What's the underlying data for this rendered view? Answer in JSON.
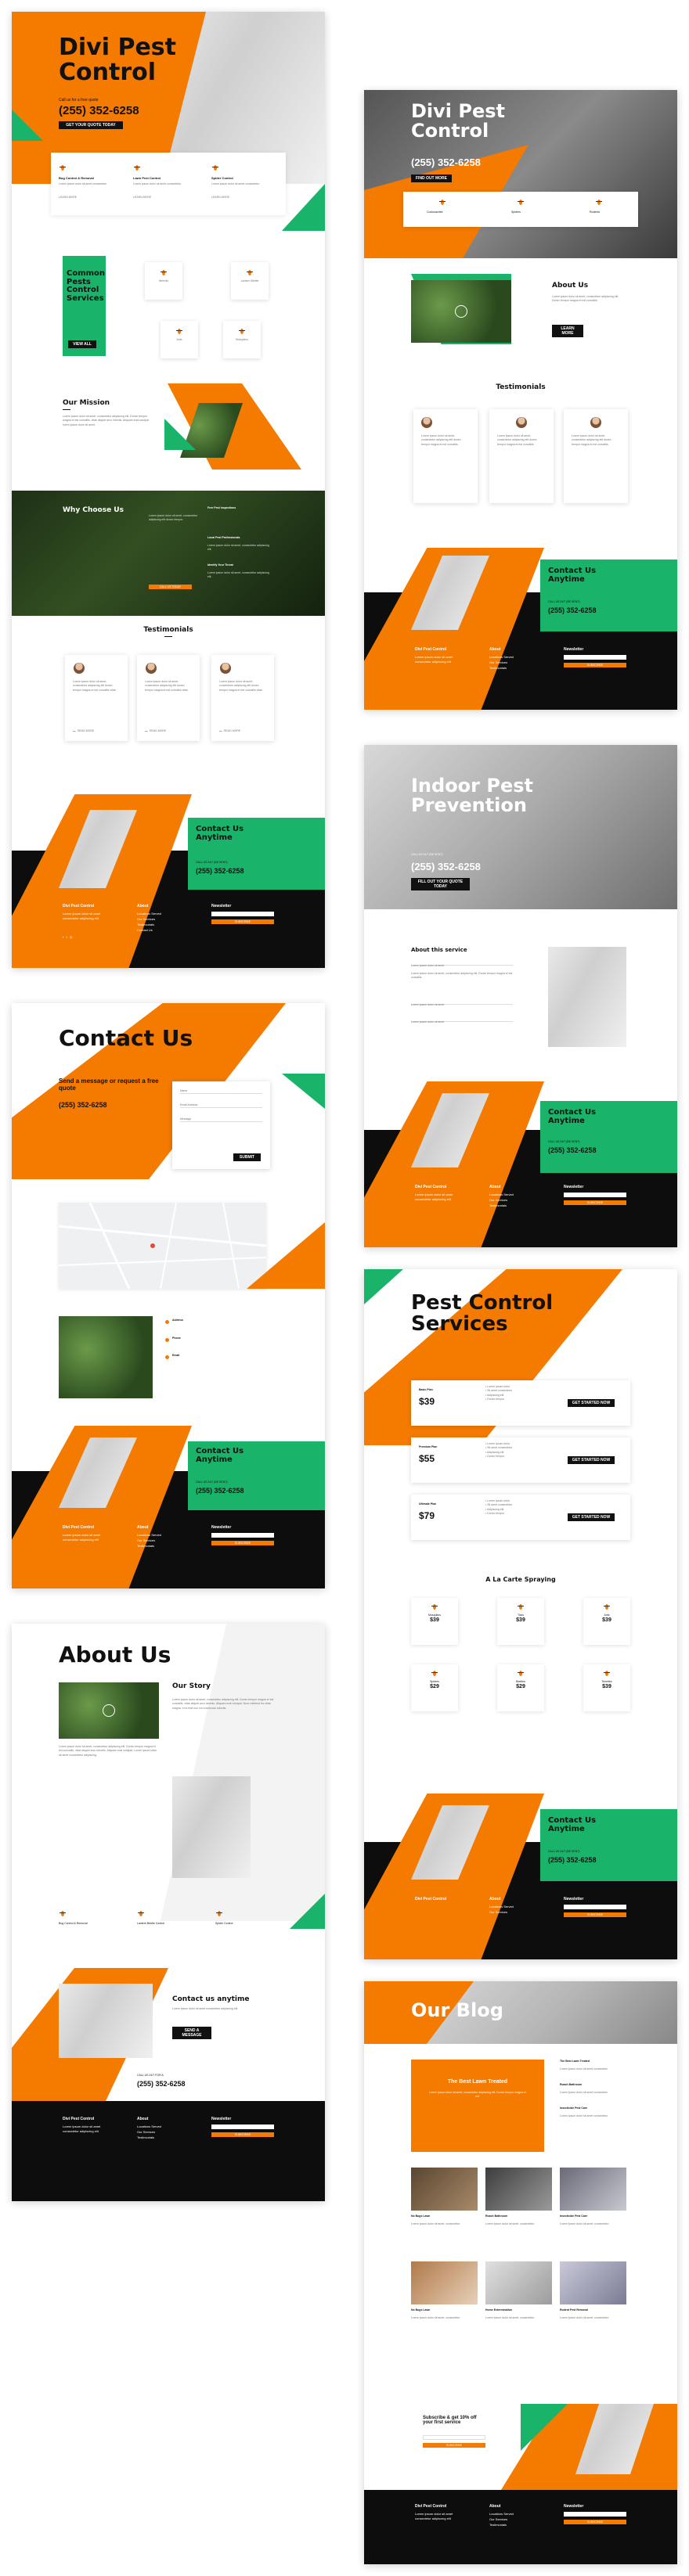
{
  "brand": {
    "orange": "#f47a00",
    "green": "#19b46a",
    "black": "#0d0d0d",
    "site_name": "Divi Pest Control"
  },
  "home": {
    "title": "Divi Pest Control",
    "subtitle": "Call us for a free quote",
    "phone": "(255) 352-6258",
    "cta": "GET YOUR QUOTE TODAY",
    "features": [
      {
        "title": "Bug Control & Removal",
        "link": "LEARN MORE"
      },
      {
        "title": "Lawn Pest Control",
        "link": "LEARN MORE"
      },
      {
        "title": "Spider Control",
        "link": "LEARN MORE"
      }
    ],
    "services_heading": "Common Pests Control Services",
    "services_button": "VIEW ALL",
    "services": [
      "Weevils",
      "Lantern Beetle",
      "Ants",
      "Mosquitos"
    ],
    "mission_heading": "Our Mission",
    "why_heading": "Why Choose Us",
    "why_items": [
      "Free Pest Inspections",
      "Local Pest Professionals",
      "Identify Your Threat"
    ],
    "why_button": "CALL US TODAY",
    "testimonials_heading": "Testimonials",
    "testimonial_link": "READ MORE"
  },
  "contact_cta": {
    "heading": "Contact Us Anytime",
    "call_label": "CALL US 24/7 (BE SENT)",
    "phone": "(255) 352-6258"
  },
  "footer": {
    "brand": "Divi Pest Control",
    "about_heading": "About",
    "about_links": [
      "Locations Served",
      "Our Services",
      "Testimonials",
      "Contact Us",
      "Locations"
    ],
    "newsletter_heading": "Newsletter",
    "subscribe": "SUBSCRIBE"
  },
  "contact_page": {
    "title": "Contact Us",
    "subtitle": "Send a message or request a free quote",
    "phone": "(255) 352-6258",
    "form_fields": [
      "Name",
      "Email Address",
      "Message"
    ],
    "submit": "SUBMIT",
    "details": [
      {
        "label": "Address"
      },
      {
        "label": "Phone"
      },
      {
        "label": "Email"
      }
    ]
  },
  "about_page": {
    "title": "About Us",
    "story_heading": "Our Story",
    "features": [
      "Bug Control & Removal",
      "Lantern Beetle Control",
      "Spider Control"
    ],
    "contact_heading": "Contact us anytime",
    "contact_button": "SEND A MESSAGE",
    "call_label": "CALL US 24/7 FOR A",
    "phone": "(255) 352-6258"
  },
  "landing_page": {
    "title": "Divi Pest Control",
    "phone": "(255) 352-6258",
    "cta": "FIND OUT MORE",
    "icons": [
      "Cockroaches",
      "Spiders",
      "Rodents"
    ],
    "about_heading": "About Us",
    "about_button": "LEARN MORE",
    "testimonials_heading": "Testimonials"
  },
  "service_page": {
    "title": "Indoor Pest Prevention",
    "call_label": "CALL US 24/7 (BE SENT)",
    "phone": "(255) 352-6258",
    "cta": "FILL OUT YOUR QUOTE TODAY",
    "about_heading": "About this service"
  },
  "pricing_page": {
    "title": "Pest Control Services",
    "plans": [
      {
        "name": "Basic Plan",
        "price": "$39",
        "button": "GET STARTED NOW"
      },
      {
        "name": "Premium Plan",
        "price": "$55",
        "button": "GET STARTED NOW"
      },
      {
        "name": "Ultimate Plan",
        "price": "$79",
        "button": "GET STARTED NOW"
      }
    ],
    "ala_heading": "A La Carte Spraying",
    "ala_items": [
      {
        "name": "Mosquitos",
        "price": "$39"
      },
      {
        "name": "Ticks",
        "price": "$39"
      },
      {
        "name": "Ants",
        "price": "$39"
      },
      {
        "name": "Spiders",
        "price": "$29"
      },
      {
        "name": "Beetles",
        "price": "$29"
      },
      {
        "name": "Termites",
        "price": "$39"
      }
    ]
  },
  "blog_page": {
    "title": "Our Blog",
    "featured_title": "The Best Lawn Treated",
    "posts": [
      "No Bugs Lawn",
      "Roach Bathroom",
      "Insecticide Pest Care",
      "No Bugs Lawn",
      "Home Extermination",
      "Rodent Pest Removal"
    ],
    "subscribe_heading": "Subscribe & get 10% off your first service",
    "subscribe_button": "SUBSCRIBE"
  }
}
